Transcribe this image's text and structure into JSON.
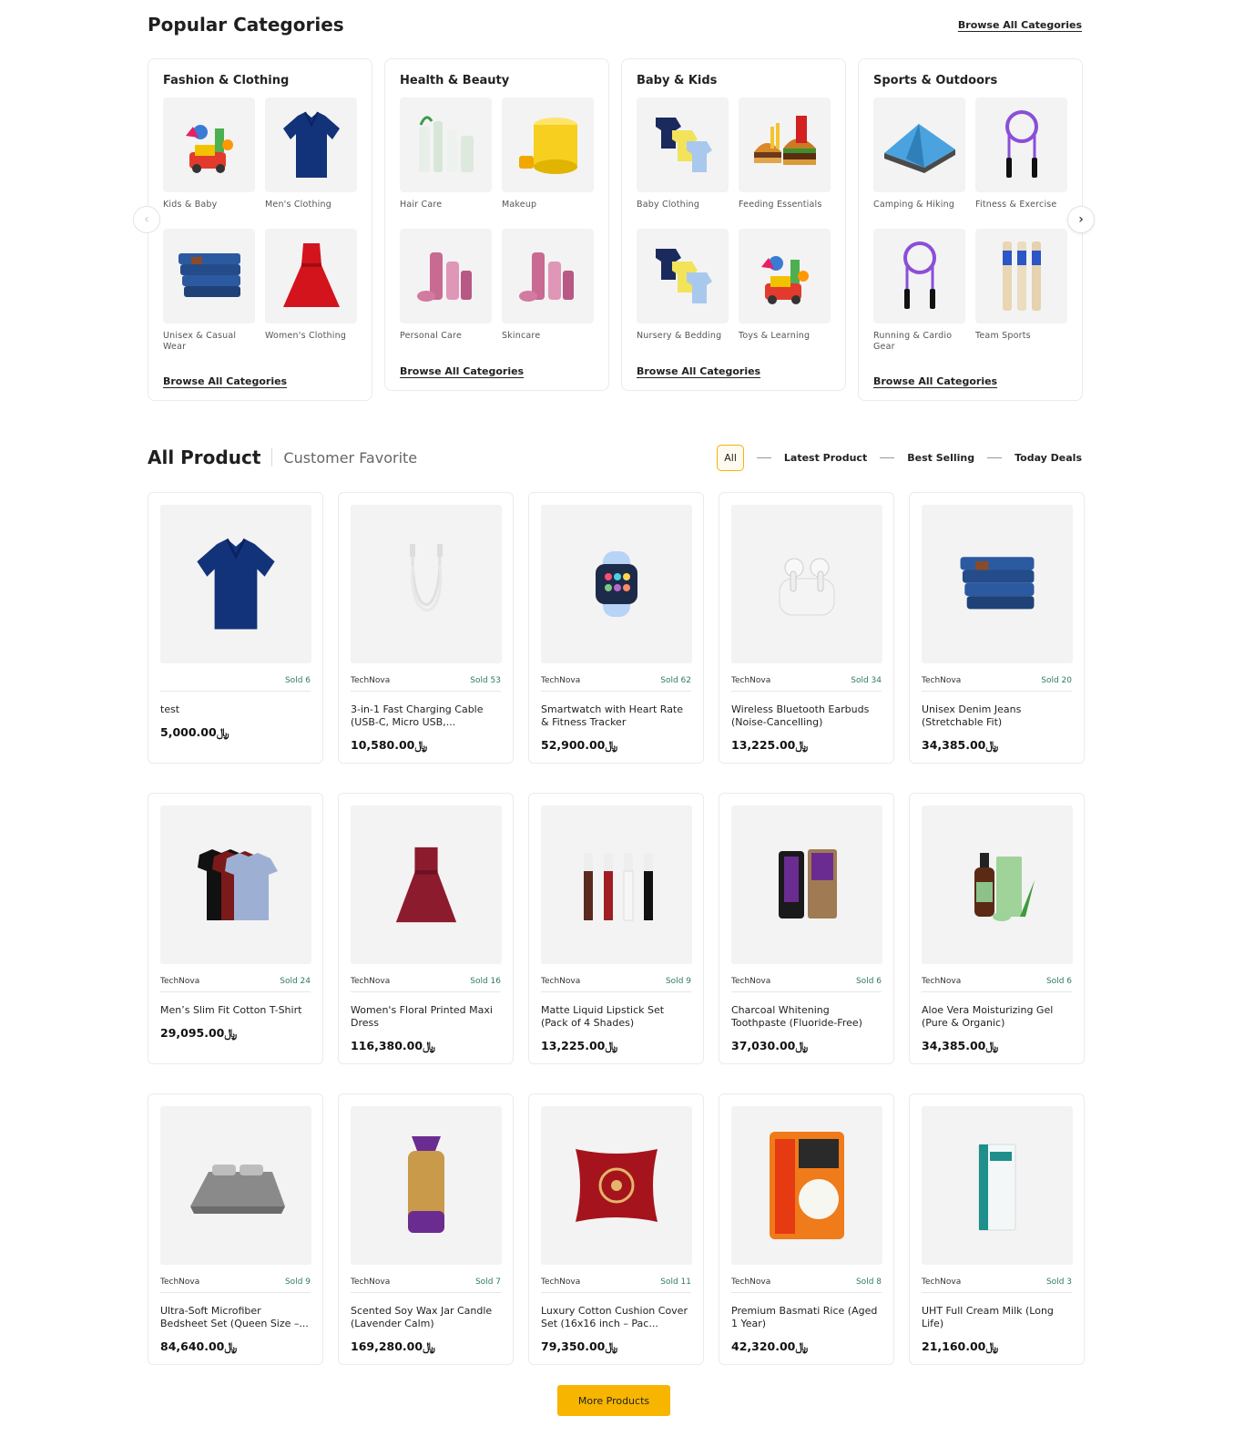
{
  "popular": {
    "title": "Popular Categories",
    "browse_all": "Browse All Categories",
    "cards": [
      {
        "title": "Fashion & Clothing",
        "link": "Browse All Categories",
        "items": [
          {
            "label": "Kids & Baby",
            "icon": "toys-icon"
          },
          {
            "label": "Men's Clothing",
            "icon": "polo-shirt-icon"
          },
          {
            "label": "Unisex & Casual Wear",
            "icon": "jeans-icon"
          },
          {
            "label": "Women's Clothing",
            "icon": "dress-icon"
          }
        ]
      },
      {
        "title": "Health & Beauty",
        "link": "Browse All Categories",
        "items": [
          {
            "label": "Hair Care",
            "icon": "bottles-icon"
          },
          {
            "label": "Makeup",
            "icon": "yellow-jar-icon"
          },
          {
            "label": "Personal Care",
            "icon": "pink-cosmetics-icon"
          },
          {
            "label": "Skincare",
            "icon": "pink-cosmetics-icon"
          }
        ]
      },
      {
        "title": "Baby & Kids",
        "link": "Browse All Categories",
        "items": [
          {
            "label": "Baby Clothing",
            "icon": "onesies-icon"
          },
          {
            "label": "Feeding Essentials",
            "icon": "burger-icon"
          },
          {
            "label": "Nursery & Bedding",
            "icon": "onesies-icon"
          },
          {
            "label": "Toys & Learning",
            "icon": "toys-icon"
          }
        ]
      },
      {
        "title": "Sports & Outdoors",
        "link": "Browse All Categories",
        "items": [
          {
            "label": "Camping & Hiking",
            "icon": "tent-icon"
          },
          {
            "label": "Fitness & Exercise",
            "icon": "jump-rope-icon"
          },
          {
            "label": "Running & Cardio Gear",
            "icon": "jump-rope-icon"
          },
          {
            "label": "Team Sports",
            "icon": "cricket-bats-icon"
          }
        ]
      }
    ]
  },
  "all_product": {
    "title": "All Product",
    "subtitle": "Customer Favorite",
    "filters": [
      "All",
      "Latest Product",
      "Best Selling",
      "Today Deals"
    ],
    "more_button": "More Products"
  },
  "products": [
    {
      "vendor": "",
      "sold": "Sold 6",
      "name": "test",
      "price": "5,000.00﷼",
      "icon": "polo-shirt-icon"
    },
    {
      "vendor": "TechNova",
      "sold": "Sold 53",
      "name": "3-in-1 Fast Charging Cable (USB-C, Micro USB,...",
      "price": "10,580.00﷼",
      "icon": "cable-icon"
    },
    {
      "vendor": "TechNova",
      "sold": "Sold 62",
      "name": "Smartwatch with Heart Rate & Fitness Tracker",
      "price": "52,900.00﷼",
      "icon": "smartwatch-icon"
    },
    {
      "vendor": "TechNova",
      "sold": "Sold 34",
      "name": "Wireless Bluetooth Earbuds (Noise-Cancelling)",
      "price": "13,225.00﷼",
      "icon": "earbuds-icon"
    },
    {
      "vendor": "TechNova",
      "sold": "Sold 20",
      "name": "Unisex Denim Jeans (Stretchable Fit)",
      "price": "34,385.00﷼",
      "icon": "jeans-icon"
    },
    {
      "vendor": "TechNova",
      "sold": "Sold 24",
      "name": "Men’s Slim Fit Cotton T-Shirt",
      "price": "29,095.00﷼",
      "icon": "tshirts-icon"
    },
    {
      "vendor": "TechNova",
      "sold": "Sold 16",
      "name": "Women's Floral Printed Maxi Dress",
      "price": "116,380.00﷼",
      "icon": "maroon-dress-icon"
    },
    {
      "vendor": "TechNova",
      "sold": "Sold 9",
      "name": "Matte Liquid Lipstick Set (Pack of 4 Shades)",
      "price": "13,225.00﷼",
      "icon": "lipstick-icon"
    },
    {
      "vendor": "TechNova",
      "sold": "Sold 6",
      "name": "Charcoal Whitening Toothpaste (Fluoride-Free)",
      "price": "37,030.00﷼",
      "icon": "toothpaste-icon"
    },
    {
      "vendor": "TechNova",
      "sold": "Sold 6",
      "name": "Aloe Vera Moisturizing Gel (Pure & Organic)",
      "price": "34,385.00﷼",
      "icon": "aloe-gel-icon"
    },
    {
      "vendor": "TechNova",
      "sold": "Sold 9",
      "name": "Ultra-Soft Microfiber Bedsheet Set (Queen Size –...",
      "price": "84,640.00﷼",
      "icon": "bedsheet-icon"
    },
    {
      "vendor": "TechNova",
      "sold": "Sold 7",
      "name": "Scented Soy Wax Jar Candle (Lavender Calm)",
      "price": "169,280.00﷼",
      "icon": "bread-bag-icon"
    },
    {
      "vendor": "TechNova",
      "sold": "Sold 11",
      "name": "Luxury Cotton Cushion Cover Set (16x16 inch – Pac...",
      "price": "79,350.00﷼",
      "icon": "cushion-icon"
    },
    {
      "vendor": "TechNova",
      "sold": "Sold 8",
      "name": "Premium Basmati Rice (Aged 1 Year)",
      "price": "42,320.00﷼",
      "icon": "rice-bag-icon"
    },
    {
      "vendor": "TechNova",
      "sold": "Sold 3",
      "name": "UHT Full Cream Milk (Long Life)",
      "price": "21,160.00﷼",
      "icon": "milk-carton-icon"
    }
  ],
  "colors": {
    "accent": "#f7b500",
    "sold": "#2e7d5b",
    "card_border": "#ebebeb",
    "image_bg": "#f3f3f3"
  }
}
